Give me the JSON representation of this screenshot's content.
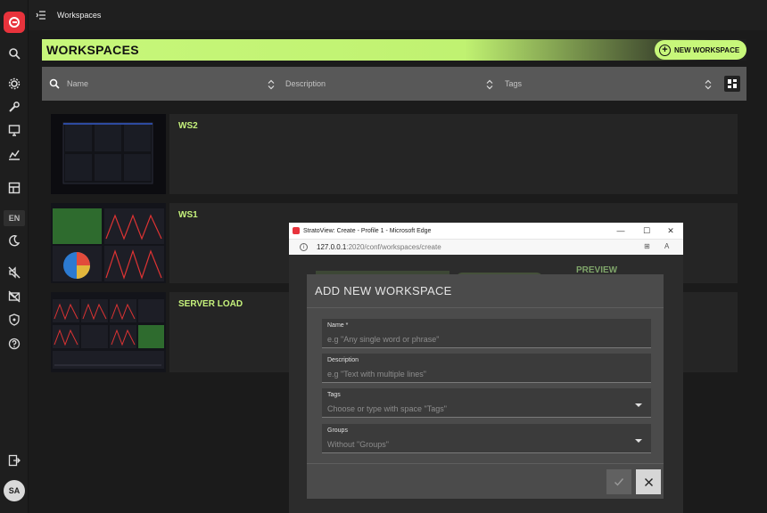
{
  "topbar": {
    "title": "Workspaces"
  },
  "rail": {
    "language": "EN",
    "user_initials": "SA",
    "icons": [
      "logo-icon",
      "search-icon",
      "settings-icon",
      "wrench-icon",
      "monitor-icon",
      "chart-icon",
      "dashboard-icon",
      "language-icon",
      "theme-icon",
      "mute-icon",
      "mail-off-icon",
      "shield-icon",
      "help-icon",
      "logout-icon",
      "avatar"
    ]
  },
  "page": {
    "title": "WORKSPACES",
    "new_button": "NEW WORKSPACE",
    "accent": "#c7f77a"
  },
  "filters": {
    "name_placeholder": "Name",
    "description_placeholder": "Description",
    "tags_placeholder": "Tags"
  },
  "workspaces": [
    {
      "name": "WS2"
    },
    {
      "name": "WS1"
    },
    {
      "name": "SERVER LOAD"
    }
  ],
  "browser": {
    "window_title": "StratoView: Create - Profile 1 - Microsoft Edge",
    "url_host": "127.0.0.1",
    "url_path": ":2020/conf/workspaces/create",
    "background_label": "PREVIEW"
  },
  "dialog": {
    "title": "ADD NEW WORKSPACE",
    "fields": [
      {
        "label": "Name *",
        "placeholder": "e.g \"Any single word or phrase\""
      },
      {
        "label": "Description",
        "placeholder": "e.g \"Text with multiple lines\""
      },
      {
        "label": "Tags",
        "placeholder": "Choose or type with space \"Tags\""
      },
      {
        "label": "Groups",
        "placeholder": "Without \"Groups\""
      }
    ]
  }
}
